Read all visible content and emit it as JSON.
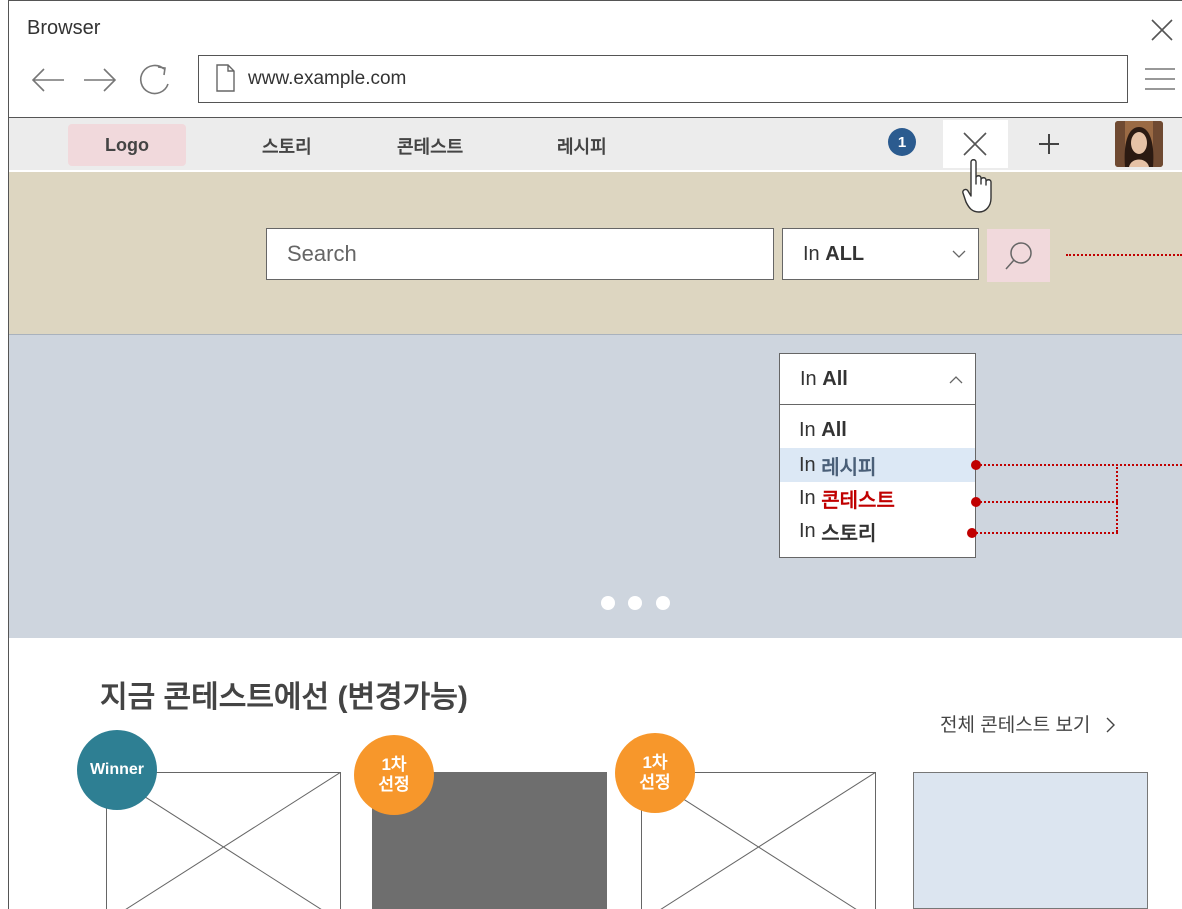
{
  "window": {
    "title": "Browser"
  },
  "address_bar": {
    "url": "www.example.com"
  },
  "site_nav": {
    "logo": "Logo",
    "menu": [
      "스토리",
      "콘테스트",
      "레시피"
    ],
    "notification_count": "1"
  },
  "search": {
    "placeholder": "Search",
    "scope_prefix": "In",
    "scope_value": "ALL"
  },
  "dropdown": {
    "prefix": "In",
    "selected": "All",
    "options": [
      {
        "prefix": "In",
        "label": "All"
      },
      {
        "prefix": "In",
        "label": "레시피"
      },
      {
        "prefix": "In",
        "label": "콘테스트"
      },
      {
        "prefix": "In",
        "label": "스토리"
      }
    ]
  },
  "carousel": {
    "slide_count": 3
  },
  "contest_section": {
    "title": "지금 콘테스트에선 (변경가능)",
    "see_all": "전체 콘테스트 보기",
    "cards": [
      {
        "badge_line1": "Winner",
        "badge_line2": ""
      },
      {
        "badge_line1": "1차",
        "badge_line2": "선정"
      },
      {
        "badge_line1": "1차",
        "badge_line2": "선정"
      },
      {
        "badge_line1": "",
        "badge_line2": ""
      }
    ]
  },
  "colors": {
    "accent_red": "#c00000",
    "badge_blue": "#2b5b8f",
    "winner_teal": "#2e7f93",
    "selected_orange": "#f7972b",
    "search_band": "#ddd6c1",
    "hero_bg": "#ced5de",
    "logo_bg": "#f1d9dc"
  },
  "icons": [
    "back-arrow-icon",
    "forward-arrow-icon",
    "refresh-icon",
    "file-icon",
    "hamburger-icon",
    "close-icon",
    "plus-icon",
    "search-icon",
    "chevron-down-icon",
    "chevron-up-icon",
    "chevron-right-icon",
    "hand-pointer-icon",
    "avatar"
  ]
}
